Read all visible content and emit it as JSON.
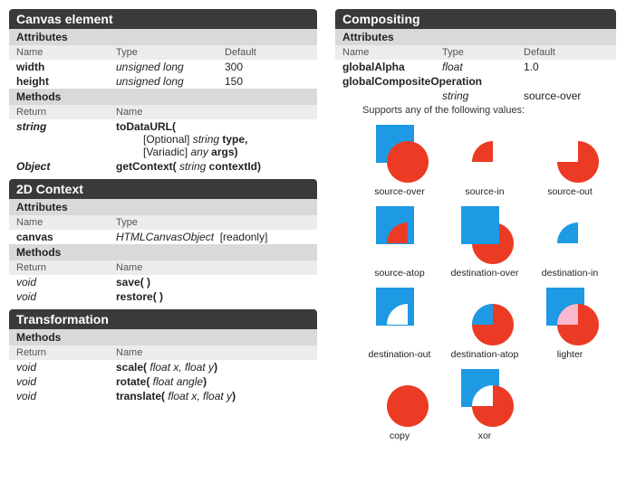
{
  "left": {
    "canvas_element": {
      "title": "Canvas element",
      "attributes": {
        "title": "Attributes",
        "headers": {
          "name": "Name",
          "type": "Type",
          "default": "Default"
        },
        "rows": [
          {
            "name": "width",
            "type": "unsigned long",
            "default": "300"
          },
          {
            "name": "height",
            "type": "unsigned long",
            "default": "150"
          }
        ]
      },
      "methods": {
        "title": "Methods",
        "headers": {
          "return": "Return",
          "name": "Name"
        },
        "rows": [
          {
            "return": "string",
            "name": "toDataURL(",
            "line2_prefix": "[Optional] ",
            "line2_ital": "string",
            "line2_suffix": " type,",
            "line3_prefix": "[Variadic] ",
            "line3_ital": "any",
            "line3_suffix": " args)"
          },
          {
            "return": "Object",
            "name_prefix": "getContext( ",
            "name_ital": "string",
            "name_suffix": " contextId)"
          }
        ]
      }
    },
    "context2d": {
      "title": "2D Context",
      "attributes": {
        "title": "Attributes",
        "headers": {
          "name": "Name",
          "type": "Type"
        },
        "rows": [
          {
            "name": "canvas",
            "type": "HTMLCanvasObject",
            "extra": "[readonly]"
          }
        ]
      },
      "methods": {
        "title": "Methods",
        "headers": {
          "return": "Return",
          "name": "Name"
        },
        "rows": [
          {
            "return": "void",
            "name": "save( )"
          },
          {
            "return": "void",
            "name": "restore( )"
          }
        ]
      }
    },
    "transform": {
      "title": "Transformation",
      "methods": {
        "title": "Methods",
        "headers": {
          "return": "Return",
          "name": "Name"
        },
        "rows": [
          {
            "return": "void",
            "name_prefix": "scale( ",
            "args": "float x, float y",
            "name_suffix": ")"
          },
          {
            "return": "void",
            "name_prefix": "rotate( ",
            "args": "float angle",
            "name_suffix": ")"
          },
          {
            "return": "void",
            "name_prefix": "translate( ",
            "args": "float x, float y",
            "name_suffix": ")"
          }
        ]
      }
    }
  },
  "right": {
    "compositing": {
      "title": "Compositing",
      "attributes": {
        "title": "Attributes",
        "headers": {
          "name": "Name",
          "type": "Type",
          "default": "Default"
        },
        "rows": [
          {
            "name": "globalAlpha",
            "type": "float",
            "default": "1.0"
          },
          {
            "name": "globalCompositeOperation",
            "type_row2": "string",
            "default_row2": "source-over"
          }
        ],
        "note": "Supports any of the following values:"
      },
      "swatches": [
        "source-over",
        "source-in",
        "source-out",
        "source-atop",
        "destination-over",
        "destination-in",
        "destination-out",
        "destination-atop",
        "lighter",
        "copy",
        "xor"
      ]
    }
  },
  "colors": {
    "blue": "#1d9ae3",
    "red": "#ec3b24",
    "pink": "#f7b8d0"
  }
}
